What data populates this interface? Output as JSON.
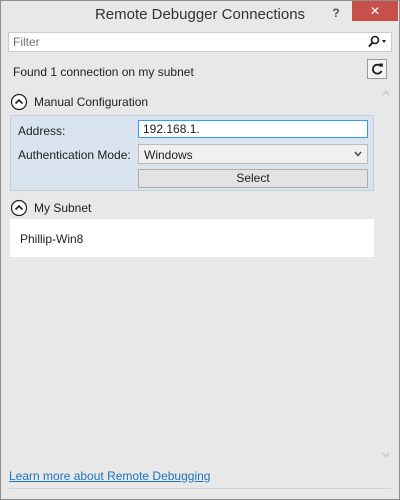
{
  "window": {
    "title": "Remote Debugger Connections",
    "help_label": "?",
    "close_label": "✕"
  },
  "filter": {
    "placeholder": "Filter",
    "value": "",
    "icon": "search-icon"
  },
  "status": {
    "text": "Found 1 connection on my subnet",
    "refresh_icon": "refresh-icon"
  },
  "manual_config": {
    "header": "Manual Configuration",
    "address_label": "Address:",
    "address_value": "192.168.1.",
    "auth_label": "Authentication Mode:",
    "auth_value": "Windows",
    "select_label": "Select"
  },
  "subnet": {
    "header": "My Subnet",
    "items": [
      {
        "name": "Phillip-Win8"
      }
    ]
  },
  "footer": {
    "link_text": "Learn more about Remote Debugging"
  },
  "colors": {
    "background": "#e8e8e8",
    "close_button": "#c7504b",
    "panel": "#d9e4ef",
    "focus_border": "#3399ff",
    "link": "#1e73be"
  }
}
